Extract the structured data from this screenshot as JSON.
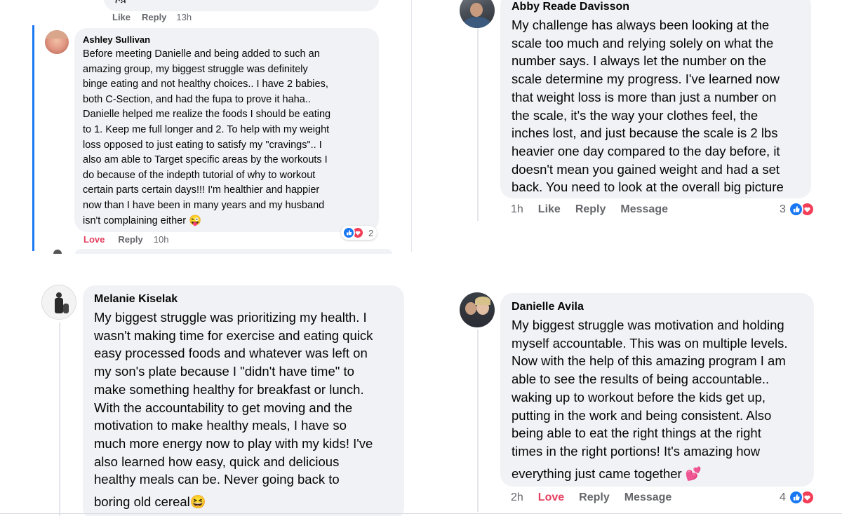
{
  "panel_tl": {
    "prev_actions": {
      "like": "Like",
      "reply": "Reply",
      "time": "13h"
    },
    "prev_tail": "ca.",
    "comment": {
      "author": "Ashley Sullivan",
      "lines": [
        "Before meeting Danielle and being added to such an",
        "amazing group, my biggest struggle was definitely",
        "binge eating and not healthy choices.. I have 2 babies,",
        "both C-Section, and had the fupa to prove it haha..",
        "Danielle helped me realize the foods I should be eating",
        "to 1. Keep me full longer and 2. To help with my weight",
        "loss opposed to just eating to satisfy my \"cravings\".. I",
        "also am able to Target specific areas by the workouts I",
        "do because of the indepth tutorial of why to workout",
        "certain parts certain days!!! I'm healthier and happier",
        "now than I have been in many years and my husband",
        "isn't complaining either"
      ],
      "emoji": "😜",
      "reaction_count": "2",
      "actions": {
        "love": "Love",
        "reply": "Reply",
        "time": "10h"
      }
    }
  },
  "panel_tr": {
    "comment": {
      "author": "Abby Reade Davisson",
      "lines": [
        "My challenge has always been looking at the",
        "scale too much and relying solely on what the",
        "number says. I always let the number on the",
        "scale determine my progress. I've learned now",
        "that weight loss is more than just a number on",
        "the scale, it's the way your clothes feel, the",
        "inches lost, and just because the scale is 2 lbs",
        "heavier one day compared to the day before, it",
        "doesn't mean you gained weight and had a set",
        "back. You need to look at the overall big picture"
      ],
      "reaction_count": "3",
      "actions": {
        "time": "1h",
        "like": "Like",
        "reply": "Reply",
        "message": "Message"
      }
    }
  },
  "panel_bl": {
    "comment": {
      "author": "Melanie Kiselak",
      "lines": [
        "My biggest struggle was prioritizing my health. I",
        "wasn't making time for exercise and eating quick",
        "easy processed foods and whatever was left on",
        "my son's plate because I \"didn't have time\" to",
        "make something healthy for breakfast or lunch.",
        "With the accountability to get moving and the",
        "motivation to make healthy meals, I have so",
        "much more energy now to play with my kids! I've",
        "also learned how easy, quick and delicious",
        "healthy meals can be. Never going back to",
        "boring old cereal"
      ],
      "emoji": "😆"
    }
  },
  "panel_br": {
    "comment": {
      "author": "Danielle Avila",
      "lines": [
        "My biggest struggle was motivation and holding",
        "myself accountable. This was on multiple levels.",
        "Now with the help of this amazing program I am",
        "able to see the results of being accountable..",
        "waking up to workout before the kids get up,",
        "putting in the work and being consistent. Also",
        "being able to eat the right things at the right",
        "times in the right portions! It's amazing how",
        "everything just came together"
      ],
      "emoji": "💕",
      "reaction_count": "4",
      "actions": {
        "time": "2h",
        "love": "Love",
        "reply": "Reply",
        "message": "Message"
      }
    }
  },
  "colors": {
    "bubble": "#f0f2f5",
    "meta_text": "#65676b",
    "love": "#e4405f",
    "like_blue": "#1877f2",
    "heart_red": "#f33e58",
    "thread_blue": "#1877f2"
  }
}
